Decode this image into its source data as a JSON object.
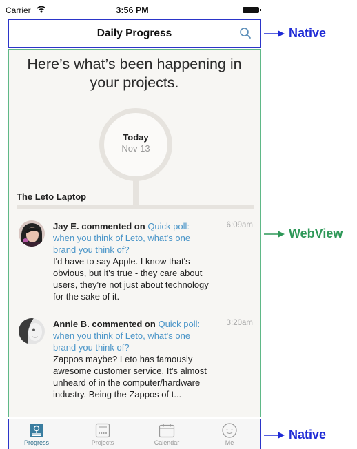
{
  "status_bar": {
    "carrier": "Carrier",
    "time": "3:56 PM"
  },
  "header": {
    "title": "Daily Progress",
    "search_icon": "search-icon"
  },
  "annotations": {
    "header": "Native",
    "content": "WebView",
    "tabbar": "Native",
    "colors": {
      "native": "#1f2bd6",
      "webview": "#2e9858"
    }
  },
  "feed": {
    "headline": "Here’s what’s been happening in your projects.",
    "day": {
      "label": "Today",
      "date": "Nov 13"
    },
    "project": "The Leto Laptop",
    "items": [
      {
        "actor": "Jay E.",
        "verb": "commented on",
        "link": "Quick poll: when you think of Leto, what's one brand you think of?",
        "text": "I'd have to say Apple. I know that's obvious, but it's true - they care about users, they're not just about technology for the sake of it.",
        "time": "6:09am"
      },
      {
        "actor": "Annie B.",
        "verb": "commented on",
        "link": "Quick poll: when you think of Leto, what's one brand you think of?",
        "text": "Zappos maybe? Leto has famously awesome customer service. It's almost unheard of in the computer/hardware industry. Being the Zappos of t...",
        "time": "3:20am"
      }
    ]
  },
  "tabs": [
    {
      "label": "Progress",
      "icon": "progress-icon",
      "active": true
    },
    {
      "label": "Projects",
      "icon": "projects-icon",
      "active": false
    },
    {
      "label": "Calendar",
      "icon": "calendar-icon",
      "active": false
    },
    {
      "label": "Me",
      "icon": "me-icon",
      "active": false
    }
  ]
}
